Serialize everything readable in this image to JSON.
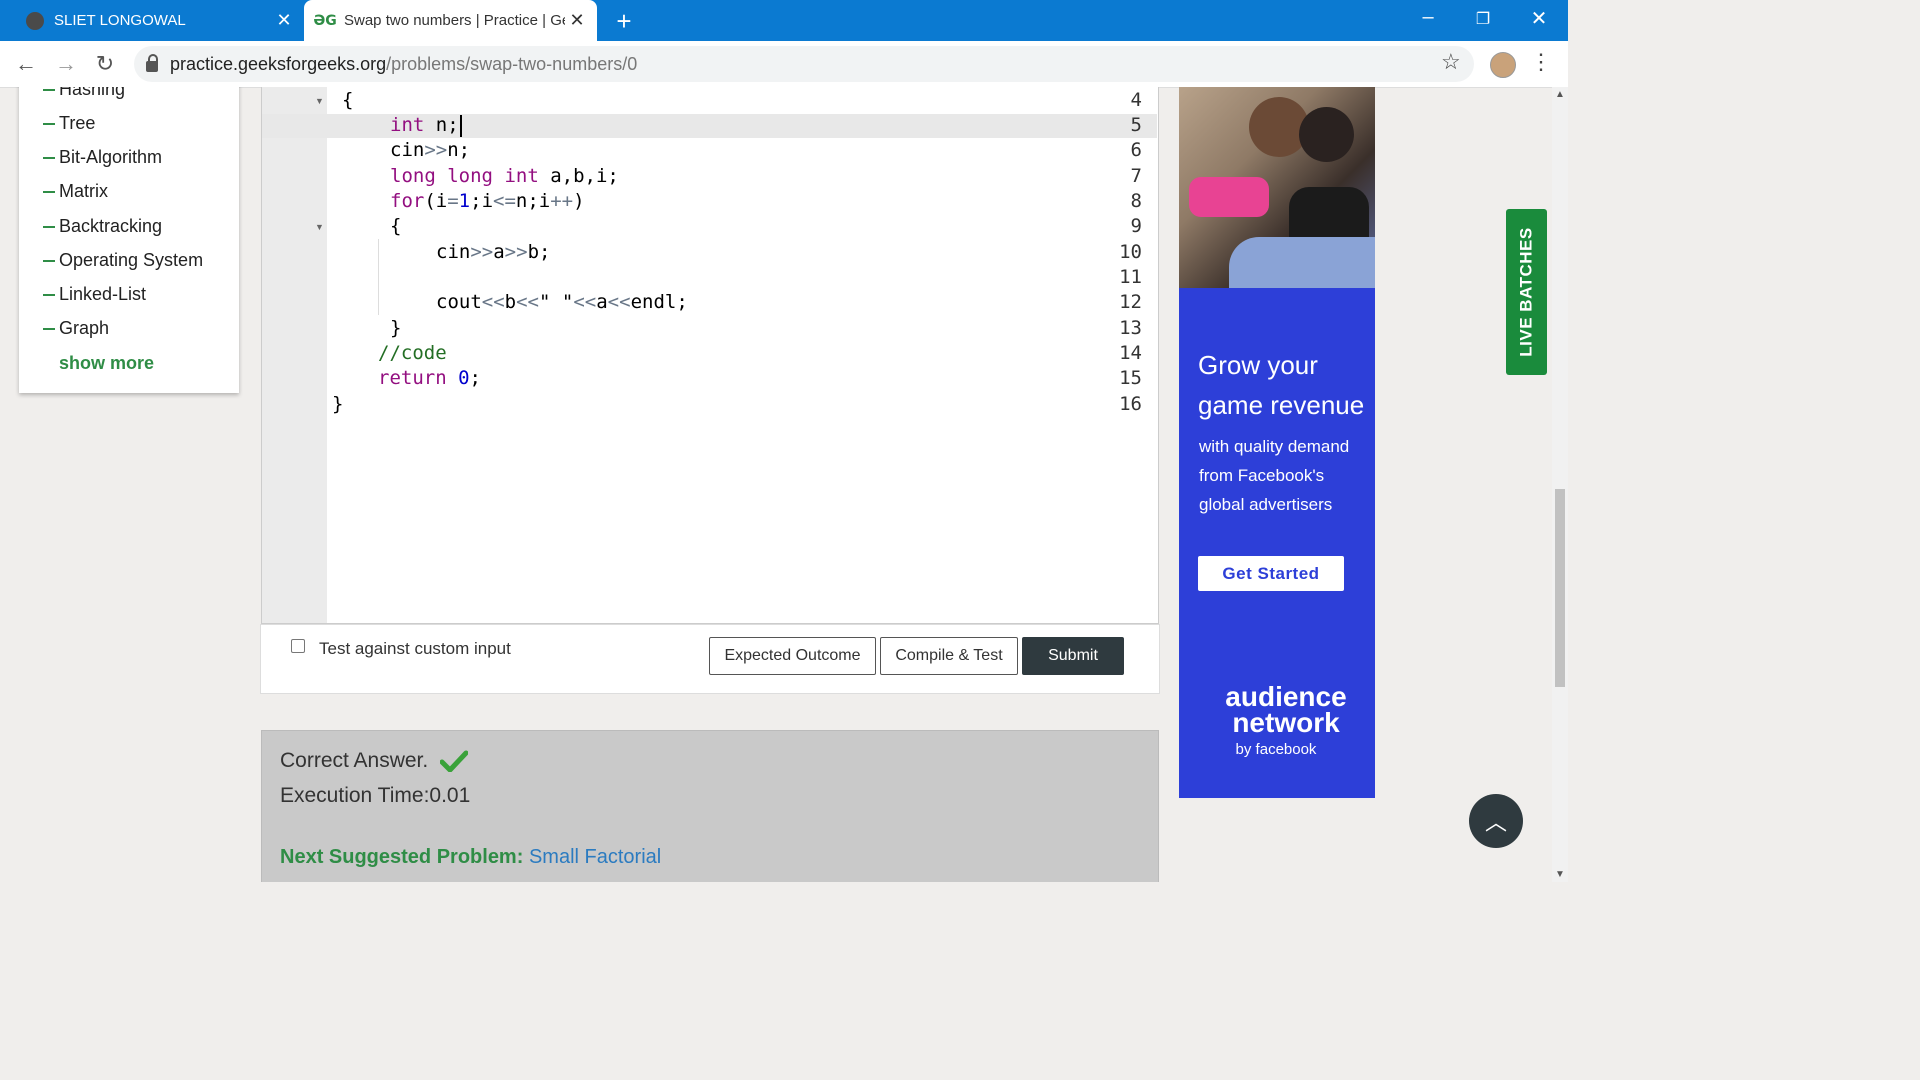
{
  "browser": {
    "tabs": [
      {
        "label": "SLIET LONGOWAL",
        "favicon": "globe-icon"
      },
      {
        "label": "Swap two numbers | Practice | Ge",
        "favicon_text": "ƏG"
      }
    ],
    "url_host": "practice.geeksforgeeks.org",
    "url_path": "/problems/swap-two-numbers/0"
  },
  "sidebar": {
    "items": [
      {
        "label": "Hashing"
      },
      {
        "label": "Tree"
      },
      {
        "label": "Bit-Algorithm"
      },
      {
        "label": "Matrix"
      },
      {
        "label": "Backtracking"
      },
      {
        "label": "Operating System"
      },
      {
        "label": "Linked-List"
      },
      {
        "label": "Graph"
      }
    ],
    "show_more": "show more"
  },
  "editor": {
    "line_numbers": [
      "4",
      "5",
      "6",
      "7",
      "8",
      "9",
      "10",
      "11",
      "12",
      "13",
      "14",
      "15",
      "16"
    ],
    "current_line": "5"
  },
  "actions": {
    "custom_input_label": "Test against custom input",
    "expected_outcome": "Expected Outcome",
    "compile_test": "Compile & Test",
    "submit": "Submit"
  },
  "result": {
    "status": "Correct Answer.",
    "exec_time": "Execution Time:0.01",
    "next_label": "Next Suggested Problem:",
    "next_problem": "Small Factorial"
  },
  "ad": {
    "headline": [
      "Grow your",
      "game revenue"
    ],
    "subtext": [
      "with quality demand",
      "from Facebook's",
      "global advertisers"
    ],
    "cta": "Get Started",
    "brand_line1": "audience",
    "brand_line2": "network",
    "brand_by": "by facebook"
  },
  "live_batches": "LIVE BATCHES",
  "colors": {
    "tabbar": "#0b7ad1",
    "gfg_green": "#2f8d46",
    "submit_bg": "#2f3a3f",
    "ad_blue": "#2d3fd8"
  }
}
